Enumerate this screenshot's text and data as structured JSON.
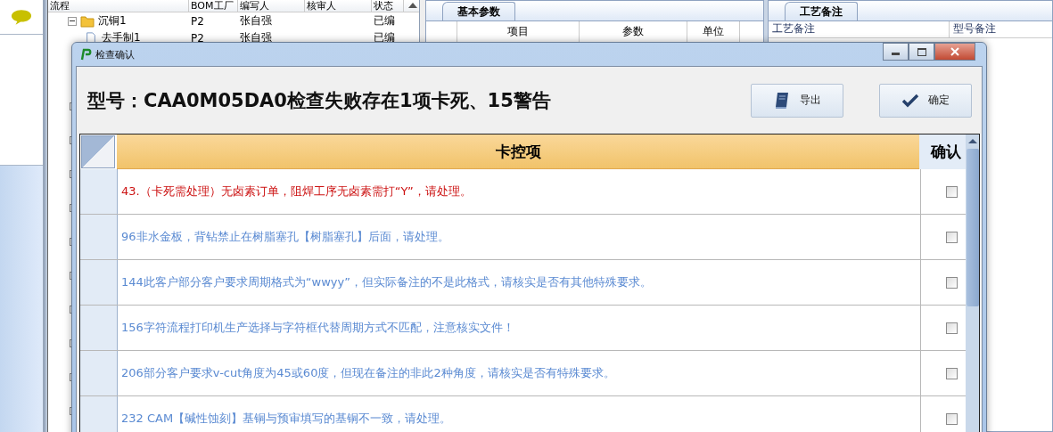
{
  "tree": {
    "columns": [
      "流程",
      "BOM工厂",
      "编写人",
      "核审人",
      "状态"
    ],
    "rows": [
      {
        "name": "沉铜1",
        "kind": "folder",
        "expanded": true,
        "factory": "P2",
        "author": "张自强",
        "reviewer": "",
        "status": "已编"
      },
      {
        "name": "去手制1",
        "kind": "file",
        "factory": "P2",
        "author": "张自强",
        "reviewer": "",
        "status": "已编"
      }
    ]
  },
  "params_panel": {
    "tab": "基本参数",
    "columns": [
      "项目",
      "参数",
      "单位"
    ]
  },
  "notes_panel": {
    "tab": "工艺备注",
    "columns": [
      "工艺备注",
      "型号备注"
    ]
  },
  "dialog": {
    "title": "检查确认",
    "heading": "型号：CAA0M05DA0检查失败存在1项卡死、15警告",
    "buttons": [
      {
        "label": "导出",
        "kind": "export"
      },
      {
        "label": "确定",
        "kind": "ok"
      }
    ],
    "grid": {
      "columns": [
        "卡控项",
        "确认"
      ],
      "rows": [
        {
          "text": "43.（卡死需处理）无卤素订单，阻焊工序无卤素需打“Y”，请处理。",
          "kind": "block",
          "checked": false
        },
        {
          "text": "96非水金板，背钻禁止在树脂塞孔【树脂塞孔】后面，请处理。",
          "kind": "warning",
          "checked": false
        },
        {
          "text": "144此客户部分客户要求周期格式为“wwyy”，但实际备注的不是此格式，请核实是否有其他特殊要求。",
          "kind": "warning",
          "checked": false
        },
        {
          "text": "156字符流程打印机生产选择与字符框代替周期方式不匹配，注意核实文件！",
          "kind": "warning",
          "checked": false
        },
        {
          "text": "206部分客户要求v-cut角度为45或60度，但现在备注的非此2种角度，请核实是否有特殊要求。",
          "kind": "warning",
          "checked": false
        },
        {
          "text": "232 CAM【碱性蚀刻】基铜与预审填写的基铜不一致，请处理。",
          "kind": "warning",
          "checked": false
        }
      ]
    }
  }
}
